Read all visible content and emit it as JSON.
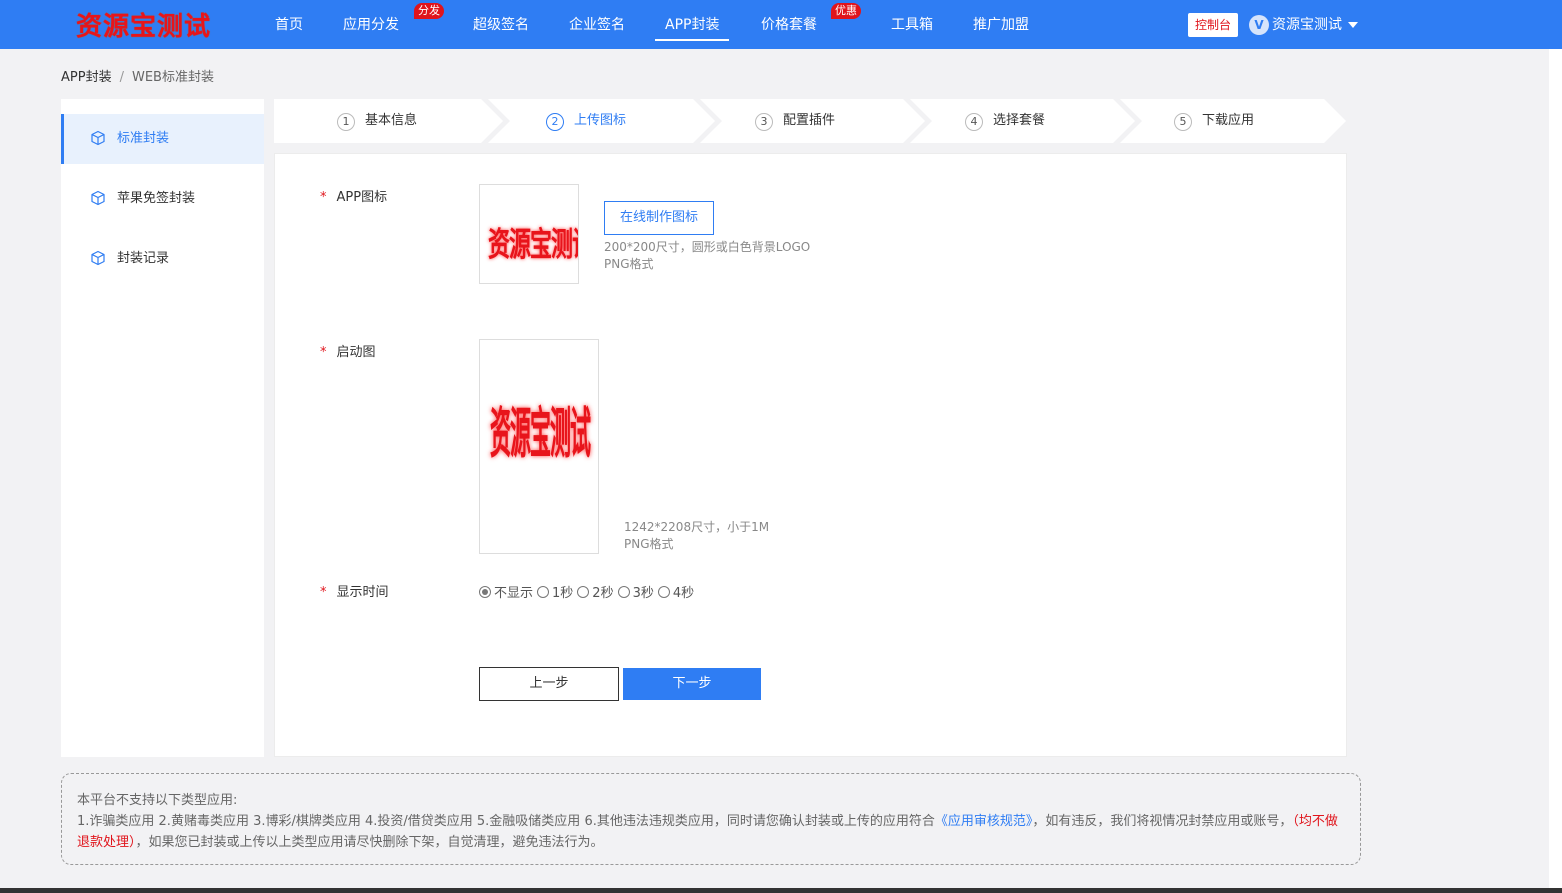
{
  "header": {
    "brand": "资源宝测试",
    "nav": [
      {
        "label": "首页",
        "badge": ""
      },
      {
        "label": "应用分发",
        "badge": "分发"
      },
      {
        "label": "超级签名",
        "badge": ""
      },
      {
        "label": "企业签名",
        "badge": ""
      },
      {
        "label": "APP封装",
        "badge": "",
        "active": true
      },
      {
        "label": "价格套餐",
        "badge": "优惠"
      },
      {
        "label": "工具箱",
        "badge": ""
      },
      {
        "label": "推广加盟",
        "badge": ""
      }
    ],
    "console_label": "控制台",
    "avatar_letter": "V",
    "user_name": "资源宝测试"
  },
  "breadcrumb": {
    "parent": "APP封装",
    "separator": "/",
    "current": "WEB标准封装"
  },
  "sidebar": {
    "items": [
      {
        "label": "标准封装",
        "active": true,
        "icon": "cube-icon"
      },
      {
        "label": "苹果免签封装",
        "active": false,
        "icon": "cube-icon"
      },
      {
        "label": "封装记录",
        "active": false,
        "icon": "cube-icon"
      }
    ]
  },
  "steps": [
    {
      "num": "1",
      "label": "基本信息"
    },
    {
      "num": "2",
      "label": "上传图标",
      "active": true
    },
    {
      "num": "3",
      "label": "配置插件"
    },
    {
      "num": "4",
      "label": "选择套餐"
    },
    {
      "num": "5",
      "label": "下载应用"
    }
  ],
  "form": {
    "required_mark": "*",
    "icon_label": "APP图标",
    "icon_preview_text": "资源宝测试",
    "make_icon_button": "在线制作图标",
    "icon_hint_line1": "200*200尺寸，圆形或白色背景LOGO",
    "icon_hint_line2": "PNG格式",
    "splash_label": "启动图",
    "splash_preview_text": "资源宝测试",
    "splash_hint_line1": "1242*2208尺寸，小于1M",
    "splash_hint_line2": "PNG格式",
    "display_time_label": "显示时间",
    "display_time_options": [
      "不显示",
      "1秒",
      "2秒",
      "3秒",
      "4秒"
    ],
    "display_time_selected": "不显示",
    "prev_button": "上一步",
    "next_button": "下一步"
  },
  "notice": {
    "title": "本平台不支持以下类型应用:",
    "body_part1": "1.诈骗类应用 2.黄赌毒类应用 3.博彩/棋牌类应用 4.投资/借贷类应用 5.金融吸储类应用 6.其他违法违规类应用，同时请您确认封装或上传的应用符合",
    "link_text": "《应用审核规范》",
    "body_part2": "，如有违反，我们将视情况封禁应用或账号，",
    "warn_text": "（均不做退款处理）",
    "body_part3": "，如果您已封装或上传以上类型应用请尽快删除下架，自觉清理，避免违法行为。"
  },
  "colors": {
    "primary": "#2f7df3",
    "brand_red": "#e8141b",
    "badge_red": "#e0141b"
  }
}
